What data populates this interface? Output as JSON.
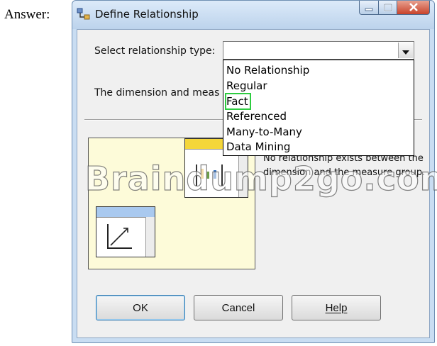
{
  "page": {
    "answer_label": "Answer:"
  },
  "window": {
    "title": "Define Relationship",
    "icons": {
      "app": "relationship-icon",
      "minimize": "minimize-icon",
      "maximize": "maximize-icon",
      "close": "close-icon"
    }
  },
  "form": {
    "relationship_type_label": "Select relationship type:",
    "relationship_type_value": "",
    "dimension_label_visible": "The dimension and meas"
  },
  "dropdown": {
    "options": [
      "No Relationship",
      "Regular",
      "Fact",
      "Referenced",
      "Many-to-Many",
      "Data Mining"
    ],
    "highlighted_index": 2,
    "highlight_color": "#2ecc40"
  },
  "description": "No relationship exists between the dimension and the measure group.",
  "watermark": "Braindump2go.com",
  "buttons": {
    "ok": "OK",
    "cancel": "Cancel",
    "help": "Help"
  },
  "colors": {
    "illustration_bg": "#fdfbd9",
    "mini_title_yellow": "#f4d63a",
    "mini_title_blue": "#a9c9ef"
  }
}
